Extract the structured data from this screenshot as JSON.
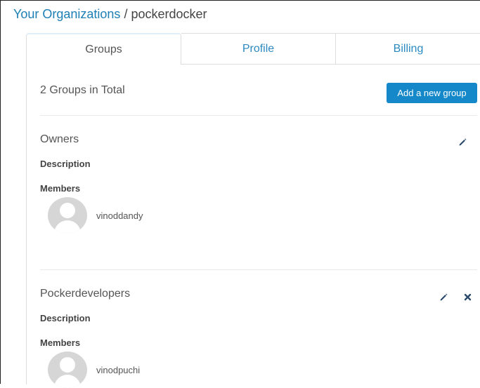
{
  "breadcrumb": {
    "parent_label": "Your Organizations",
    "separator": "/",
    "org_name": "pockerdocker"
  },
  "tabs": [
    {
      "label": "Groups",
      "active": true
    },
    {
      "label": "Profile",
      "active": false
    },
    {
      "label": "Billing",
      "active": false
    }
  ],
  "groups_panel": {
    "total_label": "2 Groups in Total",
    "add_button_label": "Add a new group",
    "groups": [
      {
        "name": "Owners",
        "description_label": "Description",
        "members_label": "Members",
        "members": [
          "vinoddandy"
        ],
        "actions": [
          "edit-icon"
        ]
      },
      {
        "name": "Pockerdevelopers",
        "description_label": "Description",
        "members_label": "Members",
        "members": [
          "vinodpuchi"
        ],
        "actions": [
          "edit-icon",
          "delete-icon"
        ]
      }
    ]
  },
  "colors": {
    "link": "#1d7fb5",
    "tab_link": "#2b8ac0",
    "primary_button": "#1488c8",
    "icon": "#2a4a6b"
  }
}
